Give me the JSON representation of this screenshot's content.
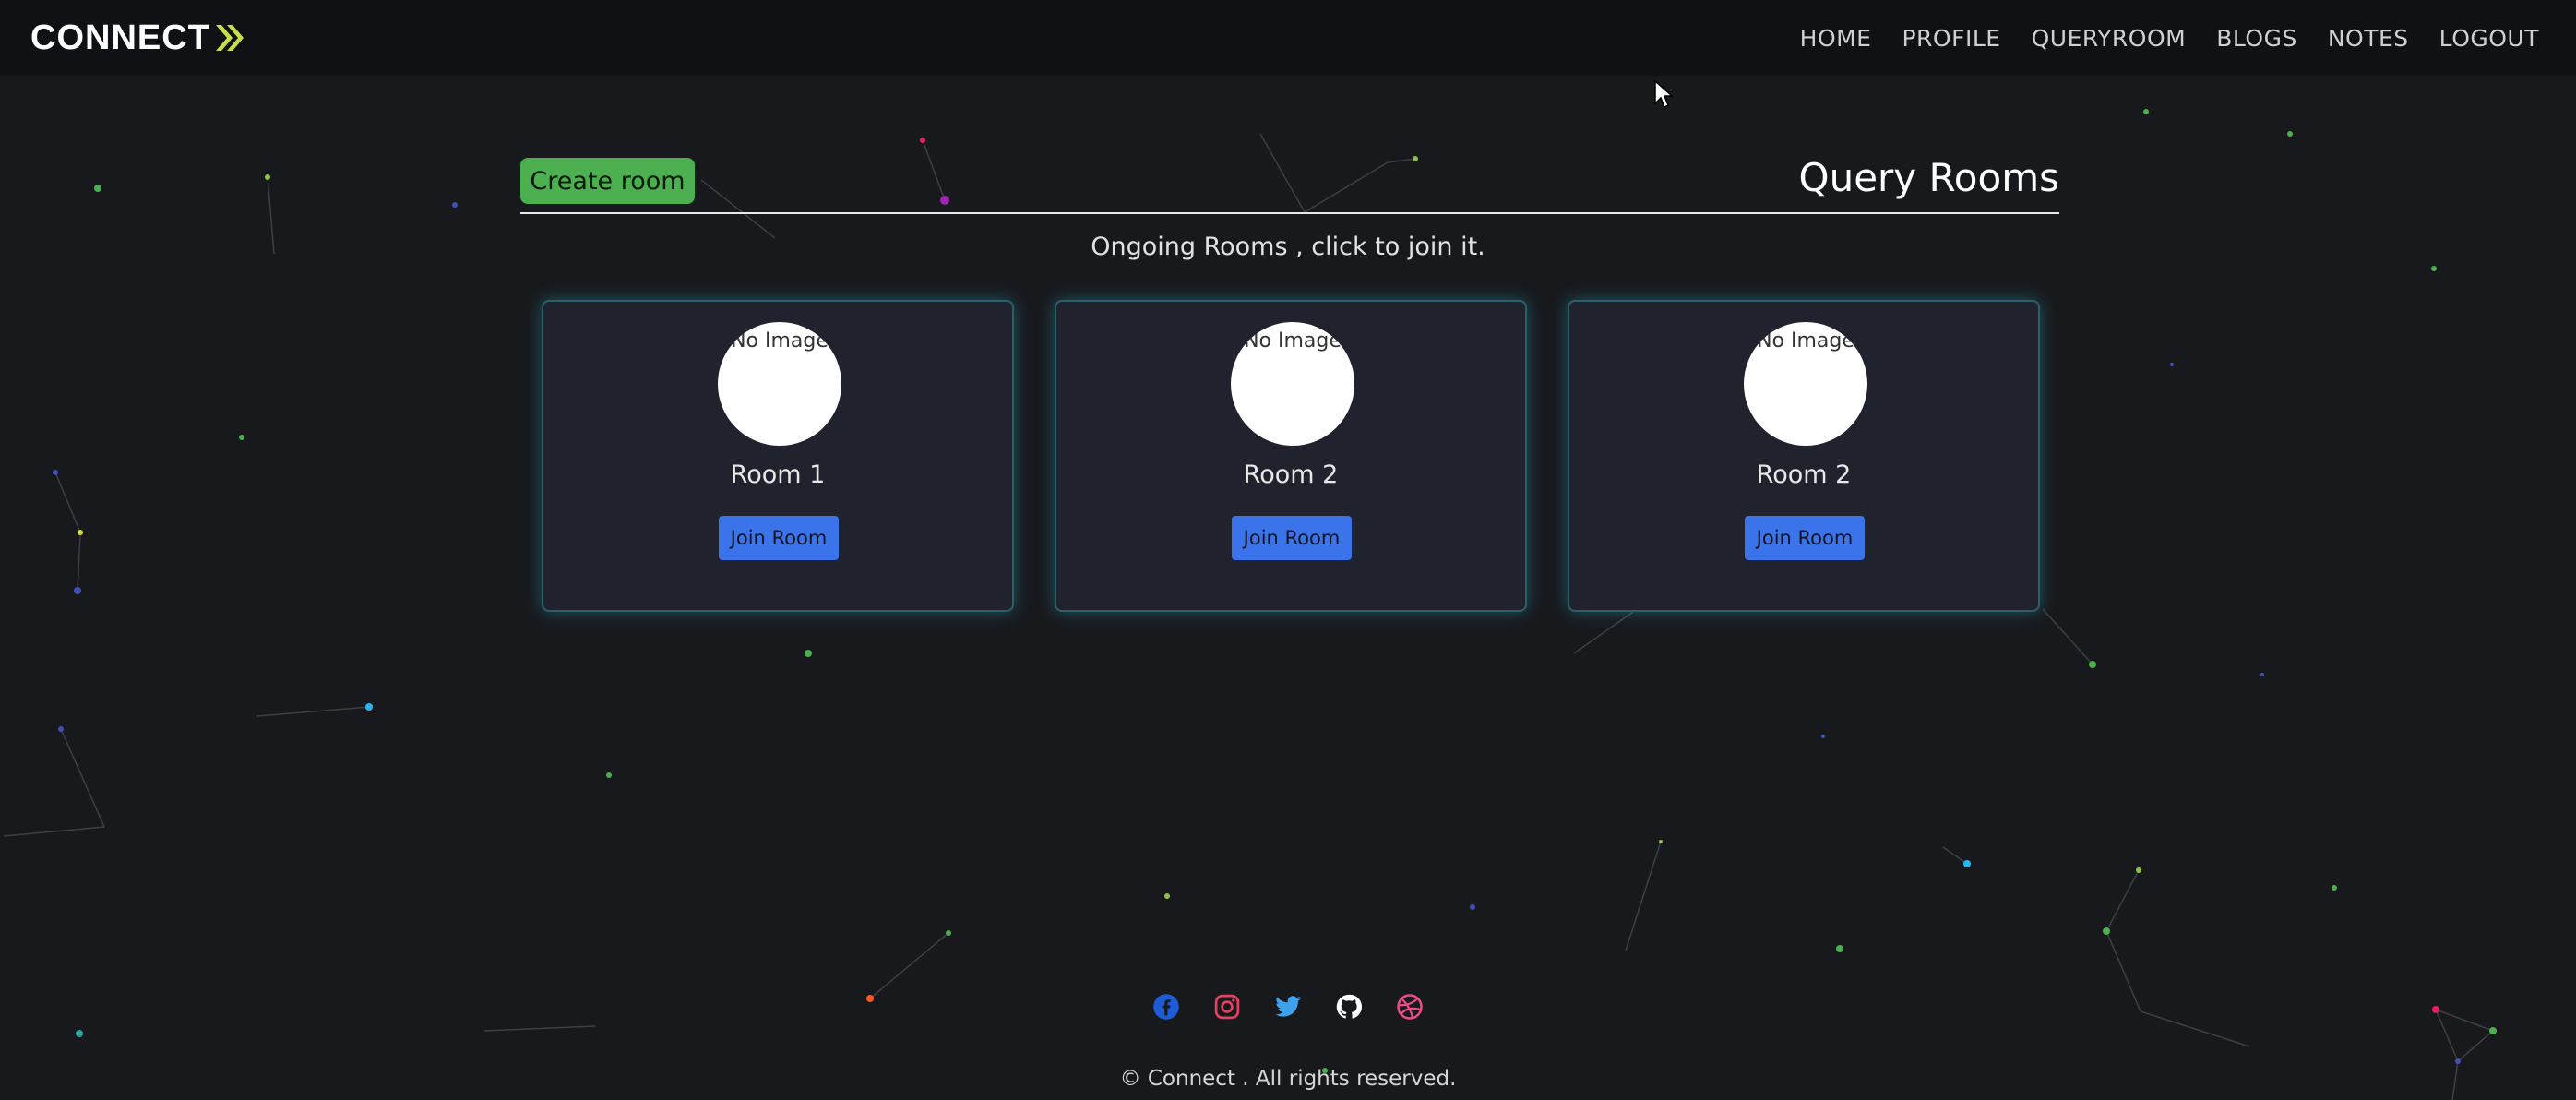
{
  "navbar": {
    "brand": "CONNECT",
    "links": [
      "HOME",
      "PROFILE",
      "QUERYROOM",
      "BLOGS",
      "NOTES",
      "LOGOUT"
    ]
  },
  "page": {
    "create_button": "Create room",
    "title": "Query Rooms",
    "subtitle": "Ongoing Rooms , click to join it."
  },
  "rooms": [
    {
      "image_alt": "No Image",
      "name": "Room 1",
      "button": "Join Room"
    },
    {
      "image_alt": "No Image",
      "name": "Room 2",
      "button": "Join Room"
    },
    {
      "image_alt": "No Image",
      "name": "Room 2",
      "button": "Join Room"
    }
  ],
  "footer": {
    "socials": [
      "facebook-icon",
      "instagram-icon",
      "twitter-icon",
      "github-icon",
      "dribbble-icon"
    ],
    "copyright": "© Connect . All rights reserved."
  },
  "colors": {
    "background": "#18191d",
    "navbar": "#101114",
    "create_button": "#4caf50",
    "join_button": "#3b74ea",
    "card": "#20232e",
    "card_glow": "#28d2e6",
    "brand_accent": "#c6e04a"
  }
}
